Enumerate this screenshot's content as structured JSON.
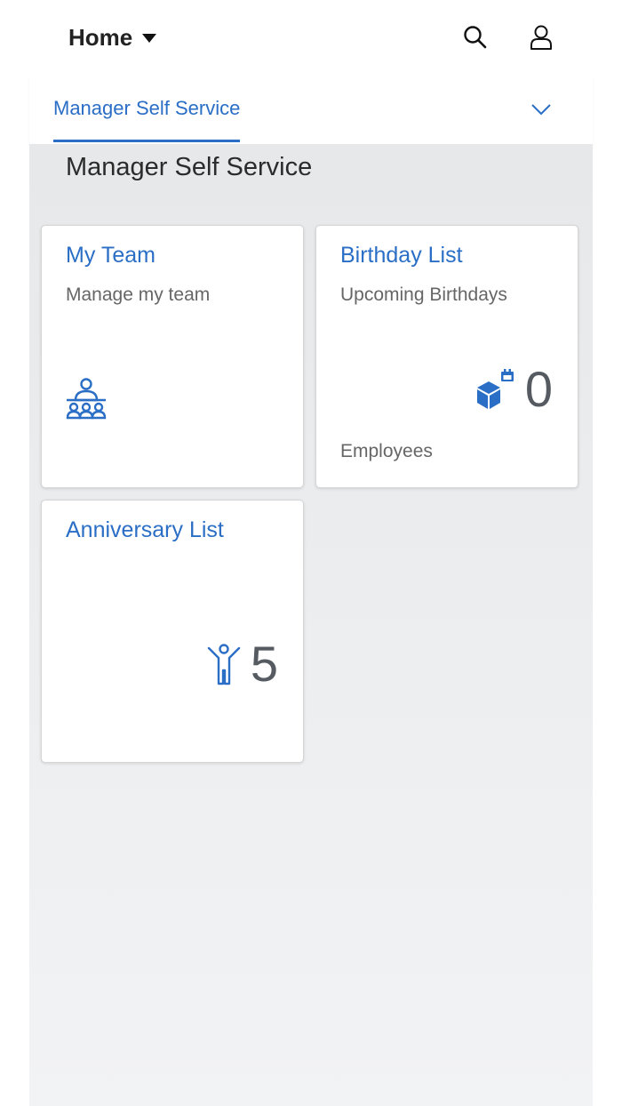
{
  "header": {
    "title": "Home",
    "icons": {
      "search": "search-icon",
      "user": "user-icon",
      "menu": "caret-down-icon"
    }
  },
  "tabs": {
    "active_label": "Manager Self Service",
    "expand_icon": "chevron-down-icon"
  },
  "section": {
    "title": "Manager Self Service"
  },
  "tiles": [
    {
      "title": "My Team",
      "subtitle": "Manage my team",
      "icon": "team-icon"
    },
    {
      "title": "Birthday List",
      "subtitle": "Upcoming Birthdays",
      "value": "0",
      "footer": "Employees",
      "icon": "gift-box-icon"
    },
    {
      "title": "Anniversary List",
      "value": "5",
      "icon": "person-cheering-icon"
    }
  ],
  "colors": {
    "accent": "#2a6ec6",
    "text": "#2b2b2b",
    "muted": "#666666",
    "page_bg": "#e6e8ea"
  }
}
